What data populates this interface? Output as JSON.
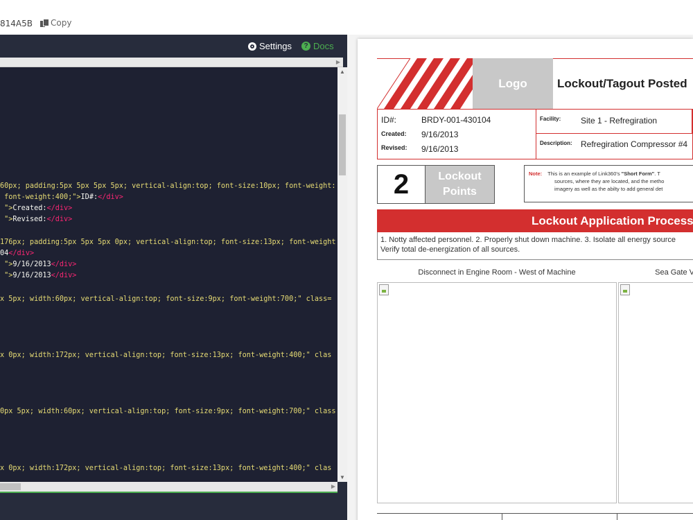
{
  "topbar": {
    "hash_fragment": "814A5B",
    "copy_label": "Copy"
  },
  "toolbar": {
    "settings_label": "Settings",
    "docs_label": "Docs"
  },
  "code_lines": [
    {
      "pre": "60px; padding:5px 5px 5px 5px; vertical-align:top; font-size:10px; font-weight:",
      "tag": "",
      "txt": ""
    },
    {
      "pre": " font-weight:400;\">",
      "txt": "ID#:",
      "tag": "</div>"
    },
    {
      "pre": " \">",
      "txt": "Created:",
      "tag": "</div>"
    },
    {
      "pre": " \">",
      "txt": "Revised:",
      "tag": "</div>"
    },
    {
      "pre": "176px; padding:5px 5px 5px 0px; vertical-align:top; font-size:13px; font-weight",
      "tag": "",
      "txt": ""
    },
    {
      "pre": "04",
      "txt": "",
      "tag": "</div>"
    },
    {
      "pre": " \">",
      "txt": "9/16/2013",
      "tag": "</div>"
    },
    {
      "pre": " \">",
      "txt": "9/16/2013",
      "tag": "</div>"
    },
    {
      "pre": "x 5px; width:60px; vertical-align:top; font-size:9px; font-weight:700;\" class=",
      "tag": "",
      "txt": ""
    },
    {
      "pre": "x 0px; width:172px; vertical-align:top; font-size:13px; font-weight:400;\" clas",
      "tag": "",
      "txt": ""
    },
    {
      "pre": "0px 5px; width:60px; vertical-align:top; font-size:9px; font-weight:700;\" class",
      "tag": "",
      "txt": ""
    },
    {
      "pre": "x 0px; width:172px; vertical-align:top; font-size:13px; font-weight:400;\" clas",
      "tag": "",
      "txt": ""
    }
  ],
  "doc": {
    "logo": "Logo",
    "title": "Lockout/Tagout Posted",
    "id_label": "ID#:",
    "id_value": "BRDY-001-430104",
    "created_label": "Created:",
    "created_value": "9/16/2013",
    "revised_label": "Revised:",
    "revised_value": "9/16/2013",
    "facility_label": "Facility:",
    "facility_value": "Site 1 - Refregiration",
    "description_label": "Description:",
    "description_value": "Refregiration Compressor #4",
    "lockout_count": "2",
    "lockout_label_1": "Lockout",
    "lockout_label_2": "Points",
    "note_label": "Note:",
    "note_line1_a": "This is an example of Link360's ",
    "note_line1_b": "\"Short Form\"",
    "note_line1_c": ". T",
    "note_line2": "sources, where they are located, and the metho",
    "note_line3": "imagery as well as the abilty to add general det",
    "process_title": "Lockout Application Process",
    "process_line1": "1. Notty affected personnel. 2. Properly shut down machine. 3. Isolate all energy source",
    "process_line2": "Verify total de-energization of all sources.",
    "caption1": "Disconnect in Engine Room - West of Machine",
    "caption2": "Sea Gate V"
  },
  "colors": {
    "accent_red": "#d32f2f",
    "editor_bg": "#272c3c",
    "docs_green": "#4caf50",
    "logo_gray": "#c8c8c8"
  }
}
